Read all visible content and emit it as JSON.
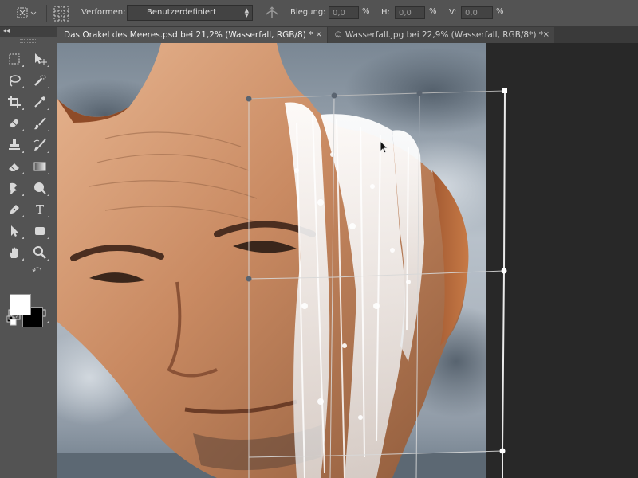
{
  "options_bar": {
    "warp_label": "Verformen:",
    "warp_value": "Benutzerdefiniert",
    "bend_label": "Biegung:",
    "bend_value": "0,0",
    "bend_unit": "%",
    "h_label": "H:",
    "h_value": "0,0",
    "h_unit": "%",
    "v_label": "V:",
    "v_value": "0,0",
    "v_unit": "%"
  },
  "tabs": [
    {
      "label": "Das Orakel des Meeres.psd bei 21,2% (Wasserfall, RGB/8) *",
      "close": "×",
      "active": true
    },
    {
      "label": "© Wasserfall.jpg bei 22,9% (Wasserfall, RGB/8*) *",
      "close": "×",
      "active": false
    }
  ],
  "toolbar": {
    "collapse": "◂◂",
    "tools": [
      "marquee-icon",
      "move-icon",
      "lasso-icon",
      "quick-selection-icon",
      "crop-icon",
      "eyedropper-icon",
      "healing-brush-icon",
      "brush-icon",
      "clone-stamp-icon",
      "history-brush-icon",
      "eraser-icon",
      "gradient-icon",
      "smudge-icon",
      "dodge-icon",
      "pen-icon",
      "type-icon",
      "path-selection-icon",
      "rectangle-icon",
      "hand-icon",
      "zoom-icon"
    ],
    "type_glyph": "T"
  },
  "colors": {
    "foreground": "#ffffff",
    "background": "#000000",
    "ui_dark": "#282828",
    "ui_panel": "#535353"
  }
}
